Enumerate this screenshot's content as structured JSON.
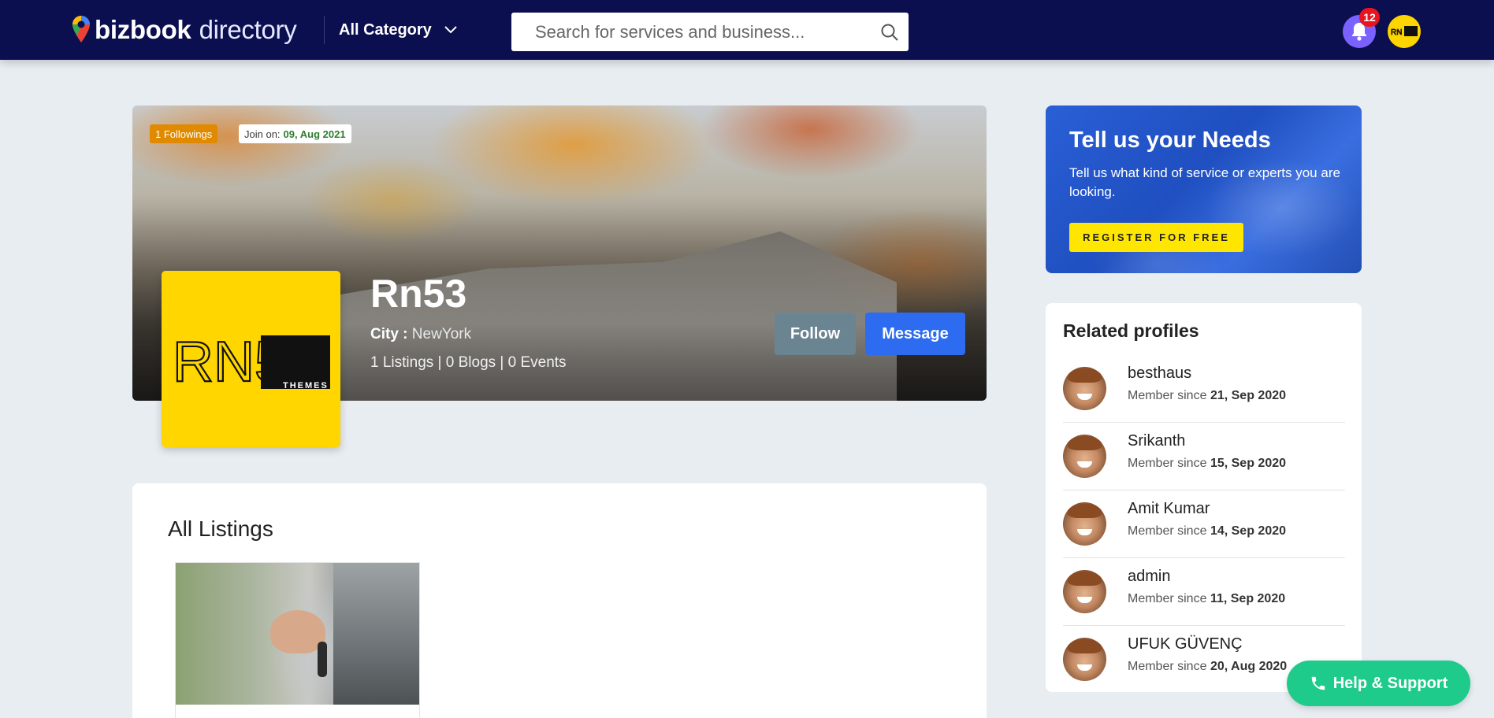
{
  "header": {
    "logo_brand": "bizbook",
    "logo_suffix": "directory",
    "category_label": "All Category",
    "search_placeholder": "Search for services and business...",
    "notification_count": "12",
    "accent_color": "#0b0f4f"
  },
  "profile": {
    "followings_chip": "1 Followings",
    "join_label": "Join on:",
    "join_date": "09, Aug 2021",
    "logo_text": "RN53",
    "logo_sub": "THEMES",
    "name": "Rn53",
    "city_label": "City :",
    "city_value": "NewYork",
    "stats": "1 Listings | 0 Blogs | 0 Events",
    "follow_label": "Follow",
    "message_label": "Message"
  },
  "listings": {
    "title": "All Listings"
  },
  "promo": {
    "title": "Tell us your Needs",
    "text": "Tell us what kind of service or experts you are looking.",
    "button_label": "REGISTER FOR FREE"
  },
  "related": {
    "title": "Related profiles",
    "since_label": "Member since",
    "items": [
      {
        "name": "besthaus",
        "since": "21, Sep 2020"
      },
      {
        "name": "Srikanth",
        "since": "15, Sep 2020"
      },
      {
        "name": "Amit Kumar",
        "since": "14, Sep 2020"
      },
      {
        "name": "admin",
        "since": "11, Sep 2020"
      },
      {
        "name": "UFUK GÜVENÇ",
        "since": "20, Aug 2020"
      }
    ]
  },
  "help": {
    "label": "Help & Support",
    "icon": "phone-icon"
  }
}
